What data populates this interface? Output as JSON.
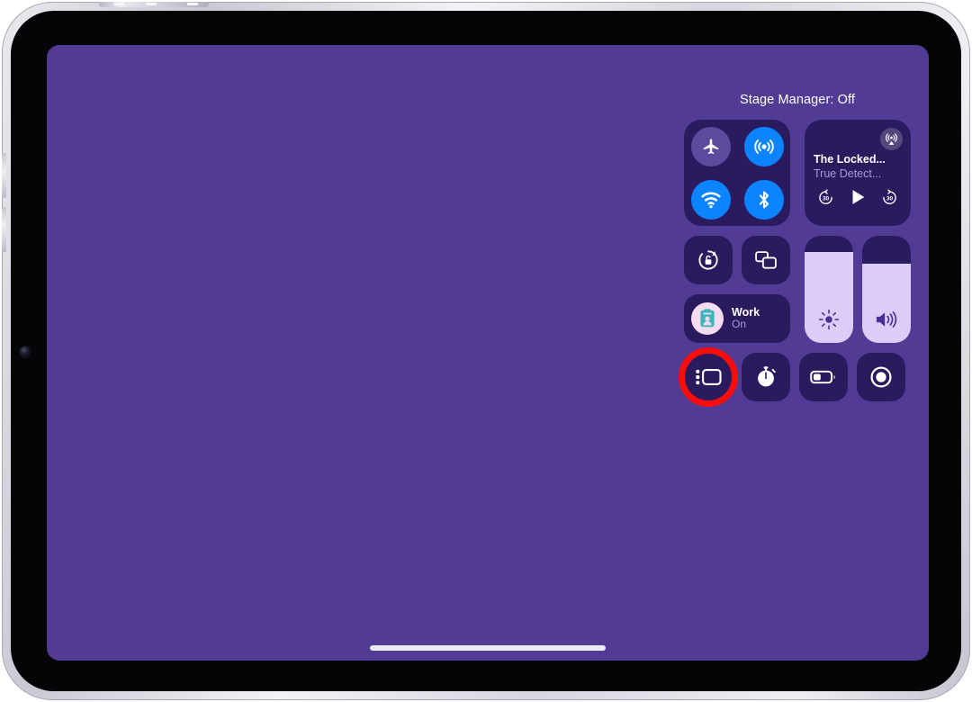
{
  "device": {
    "name": "ipad",
    "orientation": "landscape",
    "wallpaper_color": "#513b95",
    "frame_color": "#d6d6e0",
    "bezel_color": "#050507"
  },
  "control_center": {
    "stage_manager_label": "Stage Manager: Off",
    "module_bg_color": "#2a1a5e",
    "connectivity": {
      "buttons": [
        {
          "name": "airplane-mode",
          "label": "Airplane Mode",
          "state": "Off",
          "active": false,
          "color": "#5b4a9e"
        },
        {
          "name": "cellular-data",
          "label": "Cellular Data",
          "state": "On",
          "active": true,
          "color": "#0d84ff"
        },
        {
          "name": "wifi",
          "label": "Wi-Fi",
          "state": "On",
          "active": true,
          "color": "#0d84ff"
        },
        {
          "name": "bluetooth",
          "label": "Bluetooth",
          "state": "On",
          "active": true,
          "color": "#0d84ff"
        }
      ]
    },
    "media": {
      "title": "The Locked...",
      "artist": "True Detect...",
      "airplay_label": "AirPlay",
      "skip_back_label": "30",
      "skip_forward_label": "30",
      "play_label": "Play"
    },
    "rotation_lock": {
      "label": "Rotation Lock",
      "state": "On"
    },
    "screen_mirroring": {
      "label": "Screen Mirroring"
    },
    "focus": {
      "name": "Work",
      "state": "On",
      "icon_bg_color": "#f6dcf0",
      "icon_color": "#3bb6bb"
    },
    "brightness": {
      "label": "Brightness",
      "value": 85,
      "fill_color": "#dccdf8"
    },
    "volume": {
      "label": "Volume",
      "value": 74,
      "fill_color": "#dccdf8"
    },
    "bottom_row": [
      {
        "name": "stage-manager",
        "label": "Stage Manager",
        "state": "Off",
        "highlighted": true
      },
      {
        "name": "timer",
        "label": "Timer",
        "highlighted": false
      },
      {
        "name": "low-power-mode",
        "label": "Low Power Mode",
        "highlighted": false
      },
      {
        "name": "screen-recording",
        "label": "Screen Recording",
        "highlighted": false
      }
    ],
    "highlight_color": "#fb0d0d"
  }
}
